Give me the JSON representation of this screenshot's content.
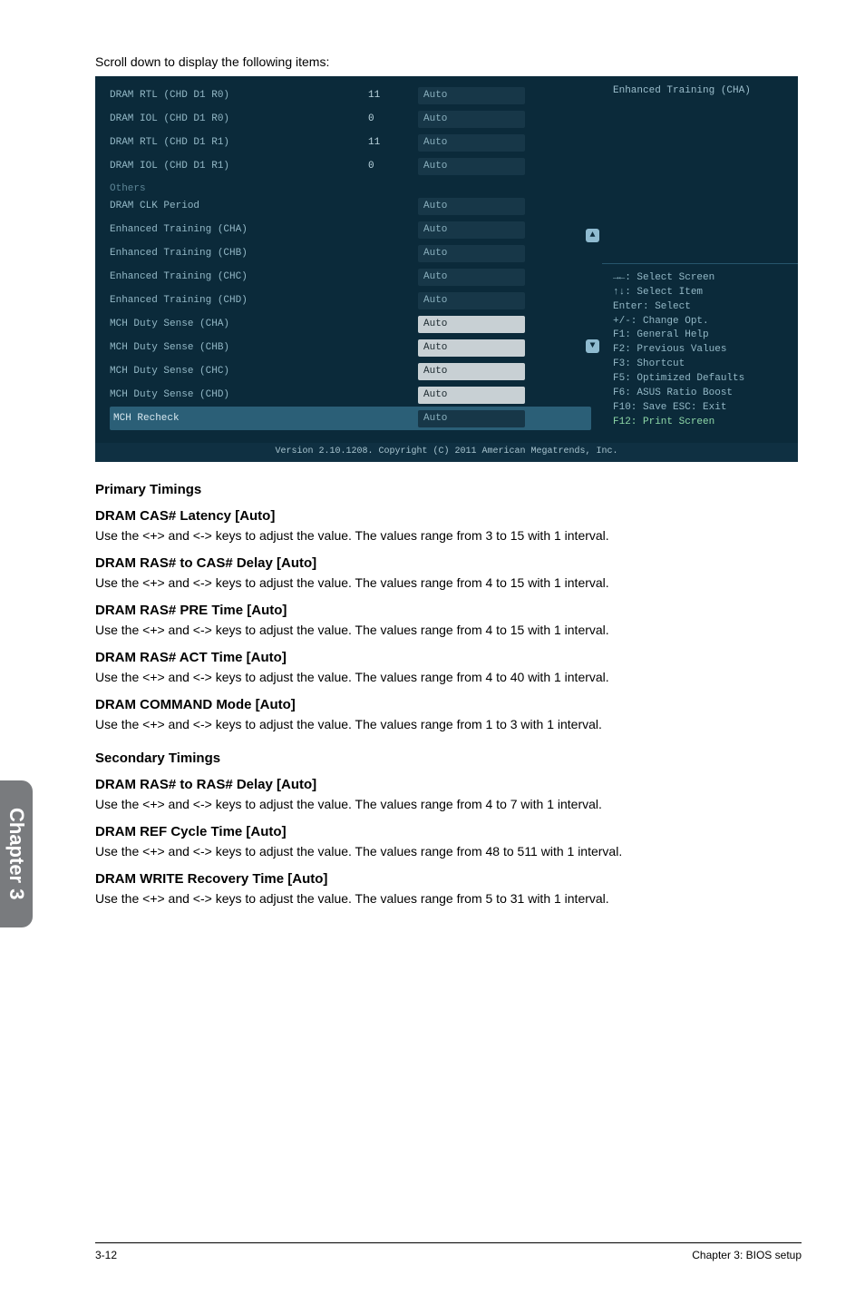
{
  "intro": "Scroll down to display the following items:",
  "bios": {
    "help_top": "Enhanced Training (CHA)",
    "rows_top": [
      {
        "label": "DRAM RTL (CHD D1 R0)",
        "num": "11",
        "field": "Auto",
        "fld": "ghost"
      },
      {
        "label": "DRAM IOL (CHD D1 R0)",
        "num": "0",
        "field": "Auto",
        "fld": "ghost"
      },
      {
        "label": "DRAM RTL (CHD D1 R1)",
        "num": "11",
        "field": "Auto",
        "fld": "ghost"
      },
      {
        "label": "DRAM IOL (CHD D1 R1)",
        "num": "0",
        "field": "Auto",
        "fld": "ghost"
      }
    ],
    "others_label": "Others",
    "rows_mid": [
      {
        "label": "DRAM CLK Period",
        "field": "Auto",
        "fld": "ghost"
      },
      {
        "label": "Enhanced Training (CHA)",
        "field": "Auto",
        "fld": "ghost"
      },
      {
        "label": "Enhanced Training (CHB)",
        "field": "Auto",
        "fld": "ghost"
      },
      {
        "label": "Enhanced Training (CHC)",
        "field": "Auto",
        "fld": "ghost"
      },
      {
        "label": "Enhanced Training (CHD)",
        "field": "Auto",
        "fld": "ghost"
      }
    ],
    "rows_bot": [
      {
        "label": "MCH Duty Sense (CHA)",
        "field": "Auto",
        "fld": "auto"
      },
      {
        "label": "MCH Duty Sense (CHB)",
        "field": "Auto",
        "fld": "auto"
      },
      {
        "label": "MCH Duty Sense (CHC)",
        "field": "Auto",
        "fld": "auto"
      },
      {
        "label": "MCH Duty Sense (CHD)",
        "field": "Auto",
        "fld": "auto"
      }
    ],
    "row_highlight": {
      "label": "MCH Recheck",
      "field": "Auto",
      "fld": "ghost"
    },
    "help_lines": [
      "→←: Select Screen",
      "↑↓: Select Item",
      "Enter: Select",
      "+/-: Change Opt.",
      "F1: General Help",
      "F2: Previous Values",
      "F3: Shortcut",
      "F5: Optimized Defaults",
      "F6: ASUS Ratio Boost",
      "F10: Save   ESC: Exit"
    ],
    "help_last": "F12: Print Screen",
    "footer": "Version 2.10.1208. Copyright (C) 2011 American Megatrends, Inc."
  },
  "scroll_up": "▲",
  "scroll_dn": "▼",
  "sections": {
    "primary_head": "Primary Timings",
    "items1": [
      {
        "h": "DRAM CAS# Latency [Auto]",
        "p": "Use the <+> and <-> keys to adjust the value. The values range from 3 to 15 with 1 interval."
      },
      {
        "h": "DRAM RAS# to CAS# Delay [Auto]",
        "p": "Use the <+> and <-> keys to adjust the value. The values range from 4 to 15 with 1 interval."
      },
      {
        "h": "DRAM RAS# PRE Time [Auto]",
        "p": "Use the <+> and <-> keys to adjust the value. The values range from 4 to 15 with 1 interval."
      },
      {
        "h": "DRAM RAS# ACT Time [Auto]",
        "p": "Use the <+> and <-> keys to adjust the value. The values range from 4 to 40 with 1 interval."
      },
      {
        "h": "DRAM COMMAND Mode [Auto]",
        "p": "Use the <+> and <-> keys to adjust the value. The values range from 1 to 3 with 1 interval."
      }
    ],
    "secondary_head": "Secondary Timings",
    "items2": [
      {
        "h": "DRAM RAS# to RAS# Delay [Auto]",
        "p": "Use the <+> and <-> keys to adjust the value. The values range from 4 to 7 with 1 interval."
      },
      {
        "h": "DRAM REF Cycle Time [Auto]",
        "p": "Use the <+> and <-> keys to adjust the value. The values range from 48 to 511 with 1 interval."
      },
      {
        "h": "DRAM WRITE Recovery Time [Auto]",
        "p": "Use the <+> and <-> keys to adjust the value. The values range from 5 to 31 with 1 interval."
      }
    ]
  },
  "side_tab": "Chapter 3",
  "footer_left": "3-12",
  "footer_right": "Chapter 3: BIOS setup"
}
